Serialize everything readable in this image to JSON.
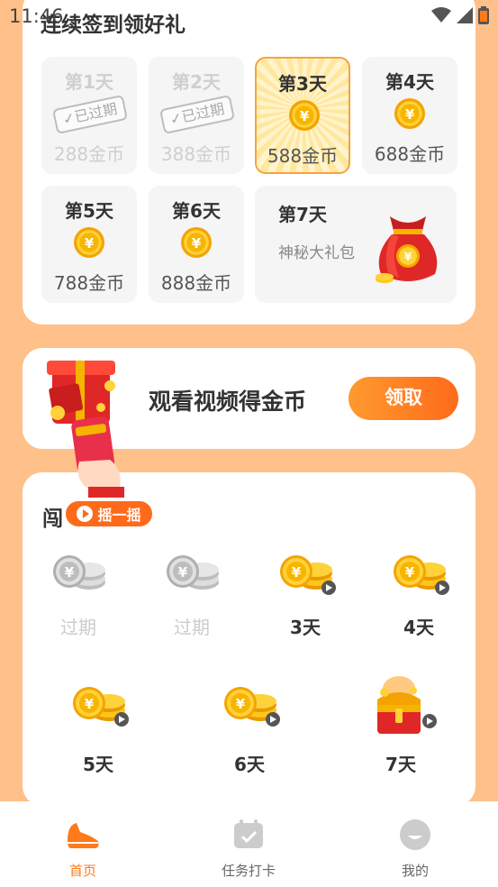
{
  "status_bar": {
    "time": "11:46"
  },
  "checkin": {
    "title": "连续签到领好礼",
    "days": [
      {
        "label": "第1天",
        "amount": "288金币",
        "state": "expired",
        "stamp": "已过期"
      },
      {
        "label": "第2天",
        "amount": "388金币",
        "state": "expired",
        "stamp": "已过期"
      },
      {
        "label": "第3天",
        "amount": "588金币",
        "state": "today"
      },
      {
        "label": "第4天",
        "amount": "688金币",
        "state": "upcoming"
      },
      {
        "label": "第5天",
        "amount": "788金币",
        "state": "upcoming"
      },
      {
        "label": "第6天",
        "amount": "888金币",
        "state": "upcoming"
      }
    ],
    "day7": {
      "label": "第7天",
      "reward": "神秘大礼包"
    }
  },
  "video": {
    "title": "观看视频得金币",
    "button": "领取"
  },
  "challenge": {
    "title": "闯",
    "shake_button": "摇一摇",
    "rewards": [
      {
        "label": "过期",
        "state": "expired"
      },
      {
        "label": "过期",
        "state": "expired"
      },
      {
        "label": "3天",
        "state": "available"
      },
      {
        "label": "4天",
        "state": "available"
      },
      {
        "label": "5天",
        "state": "available"
      },
      {
        "label": "6天",
        "state": "available"
      },
      {
        "label": "7天",
        "state": "chest"
      }
    ]
  },
  "nav": {
    "items": [
      {
        "label": "首页",
        "icon": "sneaker-icon",
        "active": true
      },
      {
        "label": "任务打卡",
        "icon": "calendar-check-icon",
        "active": false
      },
      {
        "label": "我的",
        "icon": "profile-icon",
        "active": false
      }
    ]
  },
  "colors": {
    "accent": "#FF7A1A",
    "background": "#FFC08A",
    "coin": "#FFC61A"
  }
}
